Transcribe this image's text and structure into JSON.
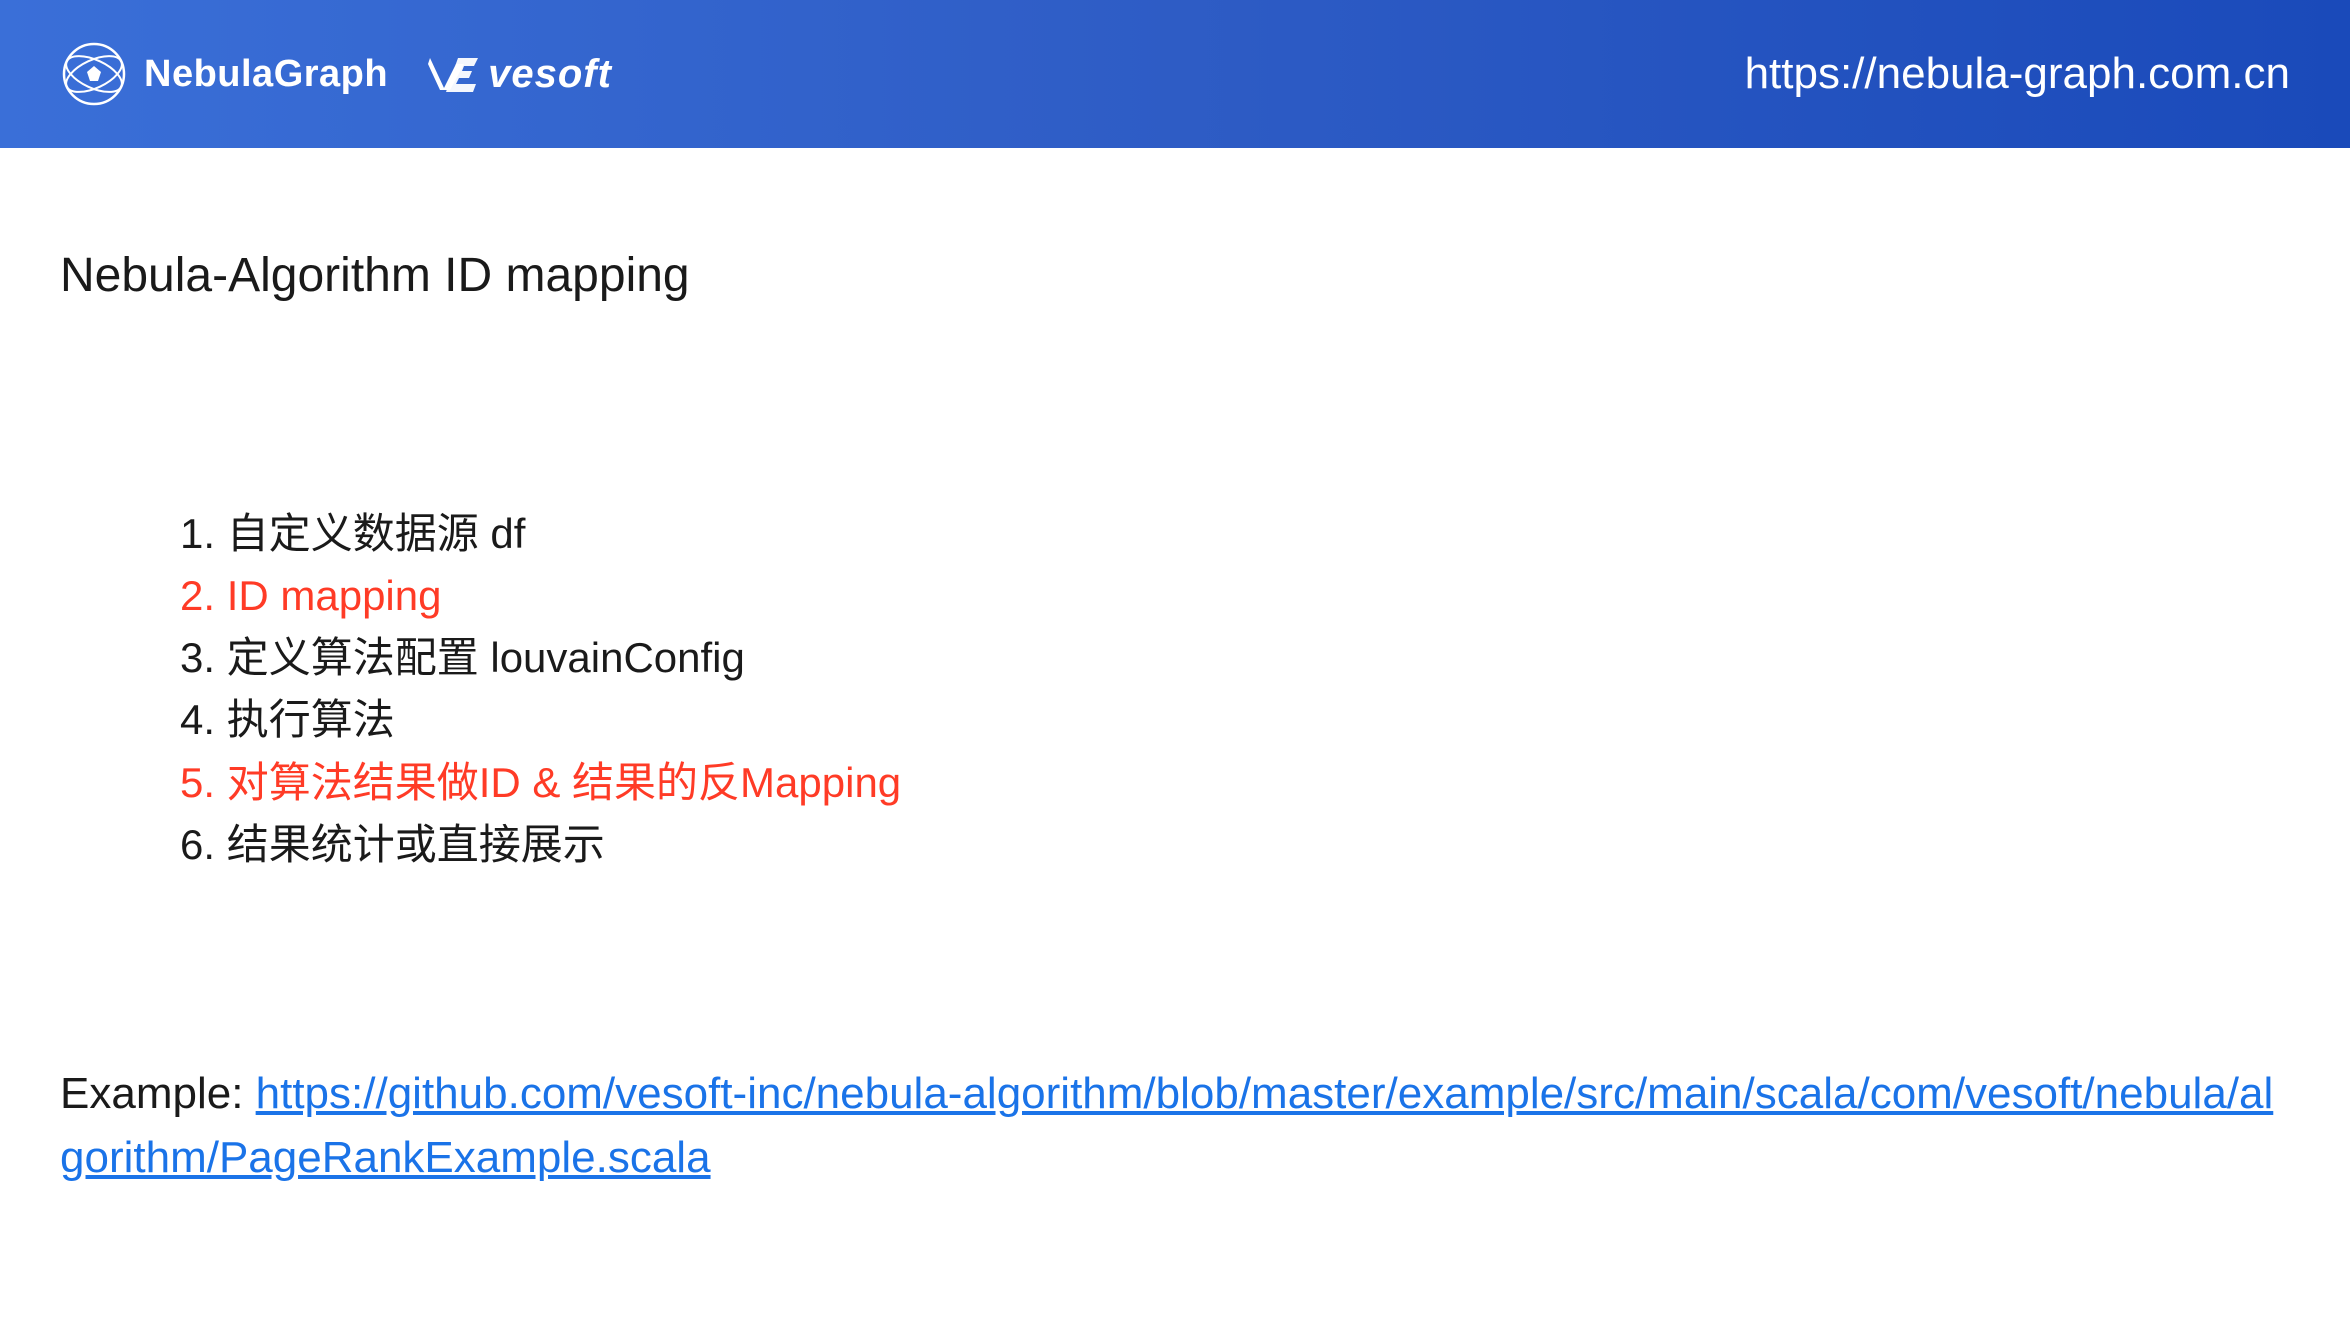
{
  "header": {
    "nebula_brand": "NebulaGraph",
    "vesoft_brand": "vesoft",
    "url": "https://nebula-graph.com.cn"
  },
  "slide": {
    "title": "Nebula-Algorithm  ID mapping"
  },
  "list": {
    "items": [
      {
        "num": "1.",
        "text": "自定义数据源 df",
        "highlighted": false
      },
      {
        "num": "2.",
        "text": "ID mapping",
        "highlighted": true
      },
      {
        "num": "3.",
        "text": "定义算法配置 louvainConfig",
        "highlighted": false
      },
      {
        "num": "4.",
        "text": "执行算法",
        "highlighted": false
      },
      {
        "num": "5.",
        "text": "对算法结果做ID & 结果的反Mapping",
        "highlighted": true
      },
      {
        "num": "6.",
        "text": "结果统计或直接展示",
        "highlighted": false
      }
    ]
  },
  "example": {
    "label": "Example:  ",
    "link_text": "https://github.com/vesoft-inc/nebula-algorithm/blob/master/example/src/main/scala/com/vesoft/nebula/algorithm/PageRankExample.scala"
  }
}
